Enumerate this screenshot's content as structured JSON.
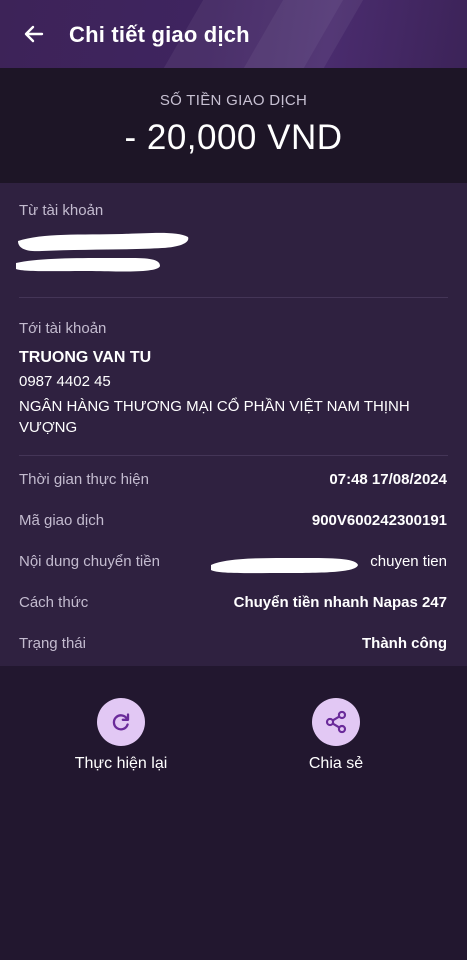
{
  "header": {
    "title": "Chi tiết giao dịch"
  },
  "amount": {
    "label": "SỐ TIỀN GIAO DỊCH",
    "value": "- 20,000 VND"
  },
  "from": {
    "label": "Từ tài khoản"
  },
  "to": {
    "label": "Tới tài khoản",
    "name": "TRUONG VAN TU",
    "account": "0987 4402 45",
    "bank": "NGÂN HÀNG THƯƠNG MẠI CỔ PHẦN VIỆT NAM THỊNH VƯỢNG"
  },
  "details": [
    {
      "label": "Thời gian thực hiện",
      "value": "07:48 17/08/2024"
    },
    {
      "label": "Mã giao dịch",
      "value": "900V600242300191"
    },
    {
      "label": "Nội dung chuyển tiền",
      "value": "chuyen tien"
    },
    {
      "label": "Cách thức",
      "value": "Chuyển tiền nhanh Napas 247"
    },
    {
      "label": "Trạng thái",
      "value": "Thành công"
    }
  ],
  "actions": {
    "repeat_label": "Thực hiện lại",
    "share_label": "Chia sẻ"
  },
  "colors": {
    "header_bg": "#3f2460",
    "card_bg": "#2f2140",
    "page_bg": "#22172f",
    "action_circle": "#e2c8f4",
    "action_icon": "#6a2a9a"
  },
  "icons": [
    "back-arrow-icon",
    "refresh-icon",
    "share-icon"
  ]
}
